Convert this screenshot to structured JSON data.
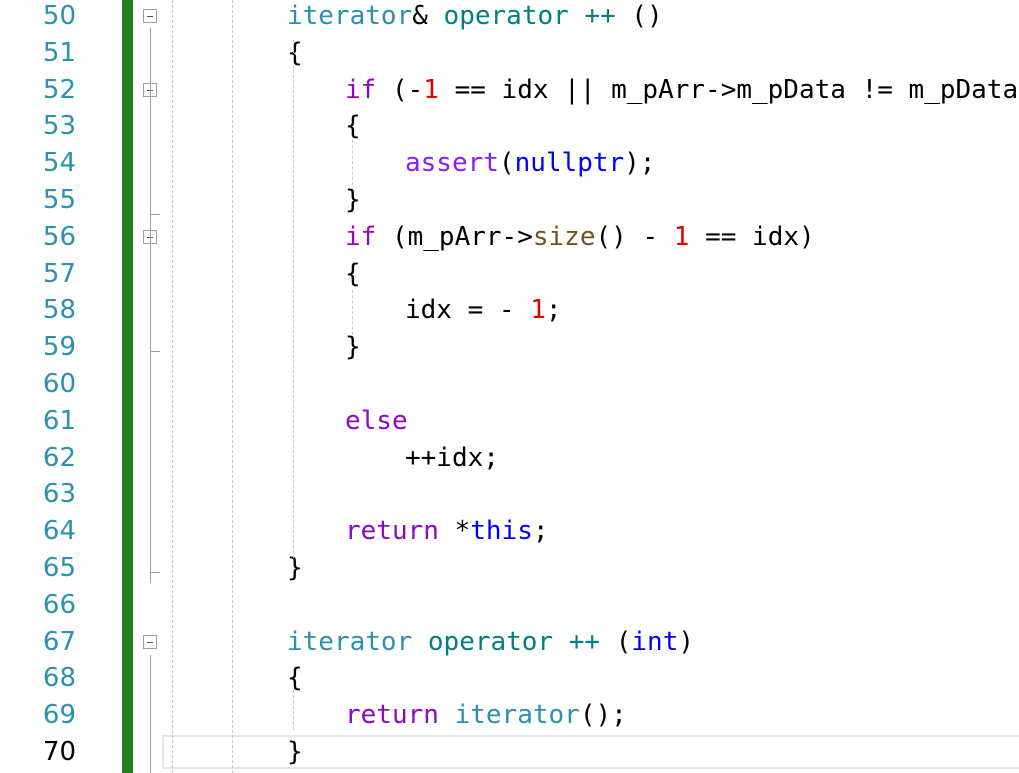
{
  "editor": {
    "current_line": "70",
    "lines": [
      {
        "n": "50",
        "indent": 0,
        "tokens": [
          [
            "iterator",
            "type"
          ],
          [
            "& ",
            "plain"
          ],
          [
            "operator ++ ",
            "op"
          ],
          [
            "()",
            "plain"
          ]
        ]
      },
      {
        "n": "51",
        "indent": 0,
        "tokens": [
          [
            "{",
            "plain"
          ]
        ]
      },
      {
        "n": "52",
        "indent": 1,
        "tokens": [
          [
            "if",
            "kw"
          ],
          [
            " (-",
            "plain"
          ],
          [
            "1",
            "num"
          ],
          [
            " == idx || m_pArr->m_pData != m_pData)",
            "plain"
          ]
        ]
      },
      {
        "n": "53",
        "indent": 1,
        "tokens": [
          [
            "{",
            "plain"
          ]
        ]
      },
      {
        "n": "54",
        "indent": 2,
        "tokens": [
          [
            "assert",
            "mac"
          ],
          [
            "(",
            "plain"
          ],
          [
            "nullptr",
            "blue"
          ],
          [
            ");",
            "plain"
          ]
        ]
      },
      {
        "n": "55",
        "indent": 1,
        "tokens": [
          [
            "}",
            "plain"
          ]
        ]
      },
      {
        "n": "56",
        "indent": 1,
        "tokens": [
          [
            "if",
            "kw"
          ],
          [
            " (m_pArr->",
            "plain"
          ],
          [
            "size",
            "fn"
          ],
          [
            "() - ",
            "plain"
          ],
          [
            "1",
            "num"
          ],
          [
            " == idx)",
            "plain"
          ]
        ]
      },
      {
        "n": "57",
        "indent": 1,
        "tokens": [
          [
            "{",
            "plain"
          ]
        ]
      },
      {
        "n": "58",
        "indent": 2,
        "tokens": [
          [
            "idx = - ",
            "plain"
          ],
          [
            "1",
            "num"
          ],
          [
            ";",
            "plain"
          ]
        ]
      },
      {
        "n": "59",
        "indent": 1,
        "tokens": [
          [
            "}",
            "plain"
          ]
        ]
      },
      {
        "n": "60",
        "indent": 0,
        "tokens": []
      },
      {
        "n": "61",
        "indent": 1,
        "tokens": [
          [
            "else",
            "kw"
          ]
        ]
      },
      {
        "n": "62",
        "indent": 2,
        "tokens": [
          [
            "++idx;",
            "plain"
          ]
        ]
      },
      {
        "n": "63",
        "indent": 0,
        "tokens": []
      },
      {
        "n": "64",
        "indent": 1,
        "tokens": [
          [
            "return",
            "kw"
          ],
          [
            " *",
            "plain"
          ],
          [
            "this",
            "blue"
          ],
          [
            ";",
            "plain"
          ]
        ]
      },
      {
        "n": "65",
        "indent": 0,
        "tokens": [
          [
            "}",
            "plain"
          ]
        ]
      },
      {
        "n": "66",
        "indent": 0,
        "tokens": []
      },
      {
        "n": "67",
        "indent": 0,
        "tokens": [
          [
            "iterator",
            "type"
          ],
          [
            " operator ++ ",
            "op"
          ],
          [
            "(",
            "plain"
          ],
          [
            "int",
            "blue"
          ],
          [
            ")",
            "plain"
          ]
        ]
      },
      {
        "n": "68",
        "indent": 0,
        "tokens": [
          [
            "{",
            "plain"
          ]
        ]
      },
      {
        "n": "69",
        "indent": 1,
        "tokens": [
          [
            "return",
            "kw"
          ],
          [
            " ",
            "plain"
          ],
          [
            "iterator",
            "type"
          ],
          [
            "();",
            "plain"
          ]
        ]
      },
      {
        "n": "70",
        "indent": 0,
        "tokens": [
          [
            "}",
            "plain"
          ]
        ]
      }
    ],
    "fold_markers": [
      "50",
      "52",
      "56",
      "67"
    ],
    "colors": {
      "change_bar": "#1e7f1e",
      "keyword": "#8f08c4",
      "type": "#2b91af",
      "number": "#e00000",
      "function": "#74531f",
      "blue_keyword": "#0000ff",
      "line_number": "#2b91af"
    }
  }
}
